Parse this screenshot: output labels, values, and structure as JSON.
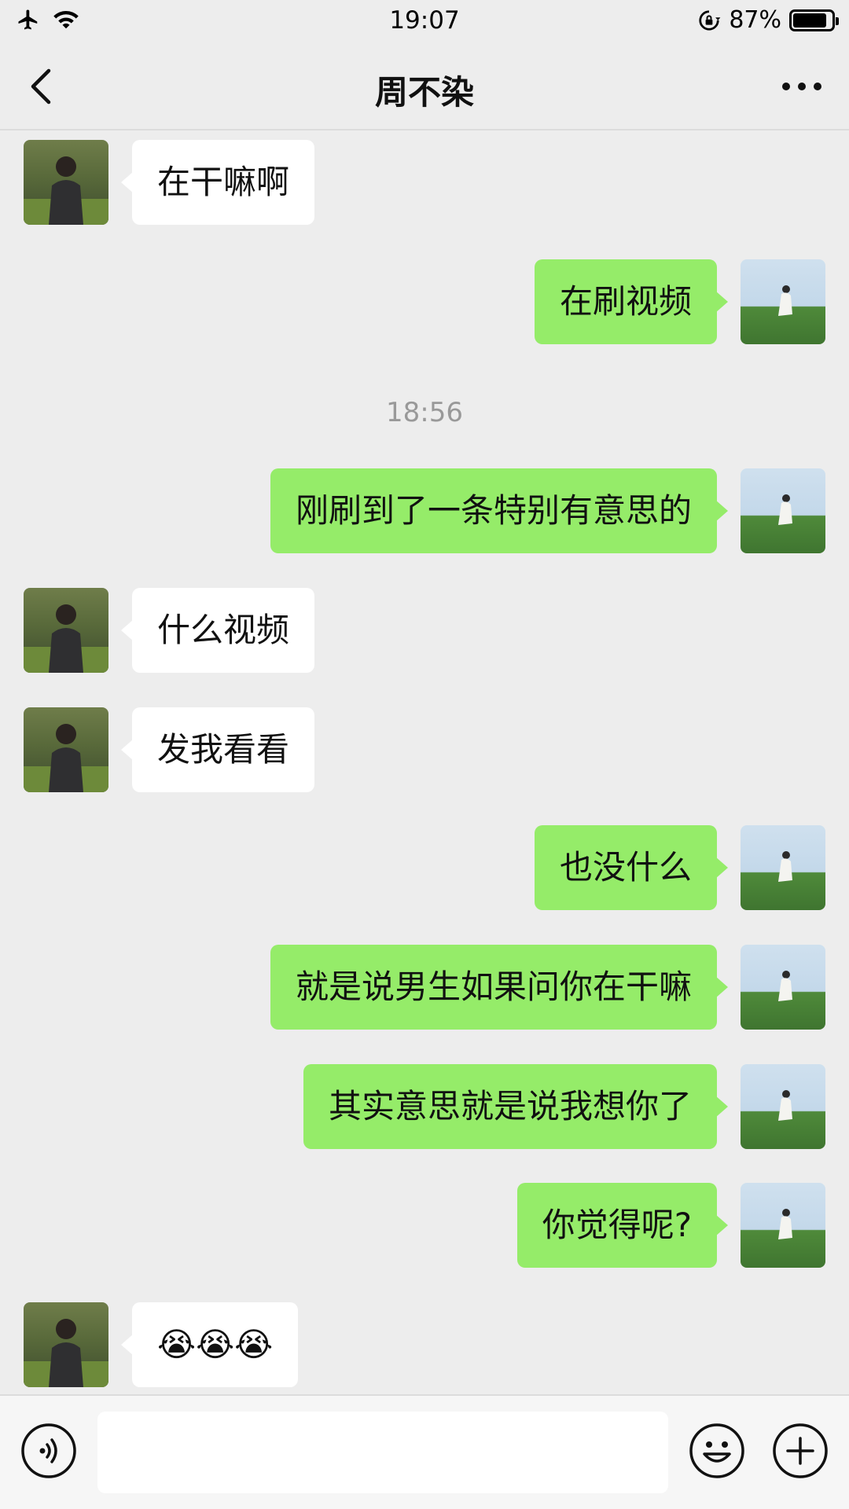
{
  "status_bar": {
    "time": "19:07",
    "battery": "87%",
    "battery_level": 0.87
  },
  "header": {
    "title": "周不染"
  },
  "timestamp": "18:56",
  "messages": [
    {
      "from": "them",
      "text": "在干嘛啊"
    },
    {
      "from": "me",
      "text": "在刷视频"
    },
    {
      "from": "me",
      "text": "刚刷到了一条特别有意思的"
    },
    {
      "from": "them",
      "text": "什么视频"
    },
    {
      "from": "them",
      "text": "发我看看"
    },
    {
      "from": "me",
      "text": "也没什么"
    },
    {
      "from": "me",
      "text": "就是说男生如果问你在干嘛"
    },
    {
      "from": "me",
      "text": "其实意思就是说我想你了"
    },
    {
      "from": "me",
      "text": "你觉得呢?"
    },
    {
      "from": "them",
      "text": "😭😭😭"
    }
  ],
  "input": {
    "value": "",
    "placeholder": ""
  },
  "colors": {
    "background": "#ededed",
    "my_bubble": "#95ec69",
    "their_bubble": "#ffffff"
  },
  "icons": [
    "airplane-icon",
    "wifi-icon",
    "rotation-lock-icon",
    "battery-icon",
    "back-icon",
    "more-icon",
    "voice-icon",
    "emoji-icon",
    "plus-icon"
  ]
}
